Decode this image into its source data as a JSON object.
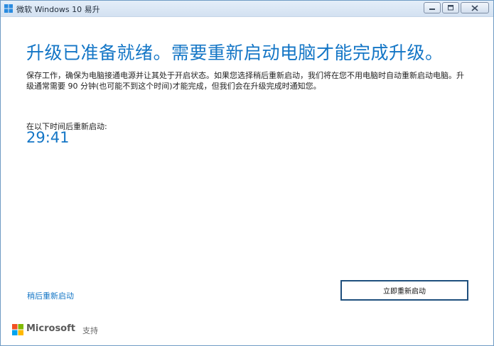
{
  "window": {
    "title": "微软 Windows 10 易升",
    "controls": [
      "minimize-icon",
      "maximize-icon",
      "close-icon"
    ]
  },
  "main": {
    "headline": "升级已准备就绪。需要重新启动电脑才能完成升级。",
    "description": "保存工作，确保为电脑接通电源并让其处于开启状态。如果您选择稍后重新启动，我们将在您不用电脑时自动重新启动电脑。升级通常需要 90 分钟(也可能不到这个时间)才能完成，但我们会在升级完成时通知您。",
    "timer_label": "在以下时间后重新启动:",
    "timer_value": "29:41"
  },
  "actions": {
    "later_link": "稍后重新启动",
    "restart_button": "立即重新启动"
  },
  "footer": {
    "brand": "Microsoft",
    "support": "支持"
  },
  "colors": {
    "accent": "#1476c6",
    "title_bar": "#d9e6f4",
    "button_border": "#1e4f7d",
    "ms_red": "#f25022",
    "ms_green": "#7fba00",
    "ms_blue": "#00a4ef",
    "ms_yellow": "#ffb900"
  }
}
